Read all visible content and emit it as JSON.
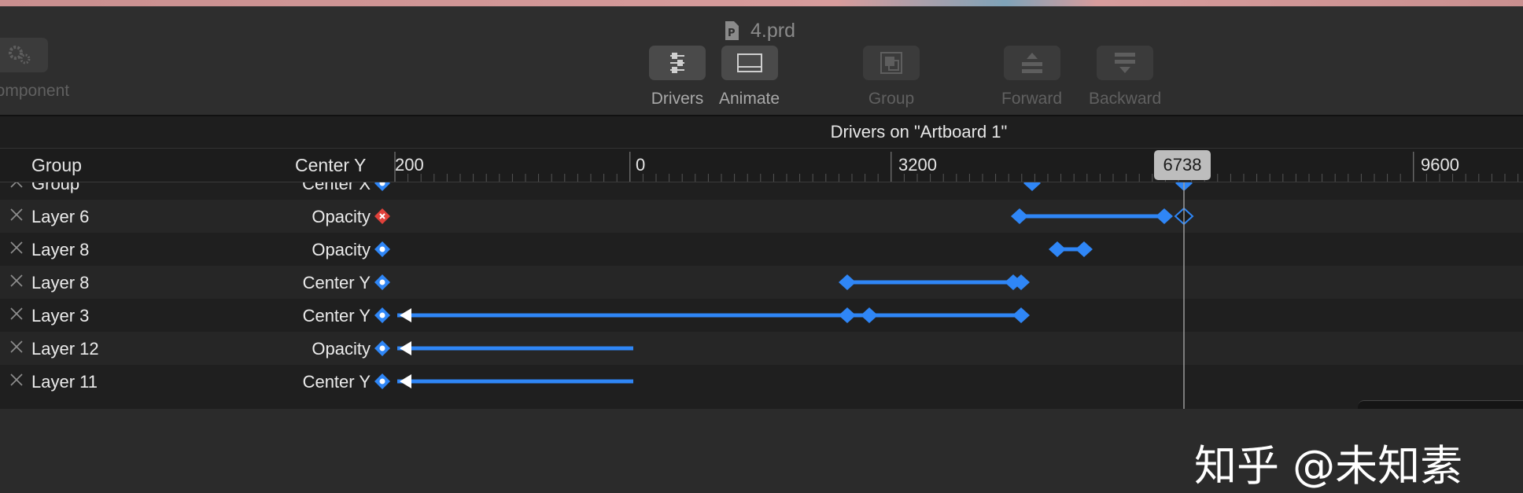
{
  "window": {
    "title": "4.prd",
    "doc_icon": "document-p-icon"
  },
  "toolbar": {
    "component_label": "e Component",
    "drivers_label": "Drivers",
    "animate_label": "Animate",
    "group_label": "Group",
    "forward_label": "Forward",
    "backward_label": "Backward"
  },
  "drivers_panel": {
    "title": "Drivers on \"Artboard 1\"",
    "col_group": "Group",
    "col_property": "Center Y",
    "ticks": [
      "200",
      "0",
      "3200",
      "6738",
      "9600"
    ],
    "current_value": "6738",
    "rows": [
      {
        "name": "Group",
        "property": "Center X",
        "state": "normal"
      },
      {
        "name": "Layer 6",
        "property": "Opacity",
        "state": "error"
      },
      {
        "name": "Layer 8",
        "property": "Opacity",
        "state": "normal"
      },
      {
        "name": "Layer 8",
        "property": "Center Y",
        "state": "normal"
      },
      {
        "name": "Layer 3",
        "property": "Center Y",
        "state": "normal"
      },
      {
        "name": "Layer 12",
        "property": "Opacity",
        "state": "normal"
      },
      {
        "name": "Layer 11",
        "property": "Center Y",
        "state": "normal"
      }
    ],
    "colors": {
      "keyframe": "#2f86f6",
      "error": "#e0413a",
      "playhead": "#9a9a9a"
    }
  },
  "watermark": "知乎 @未知素"
}
